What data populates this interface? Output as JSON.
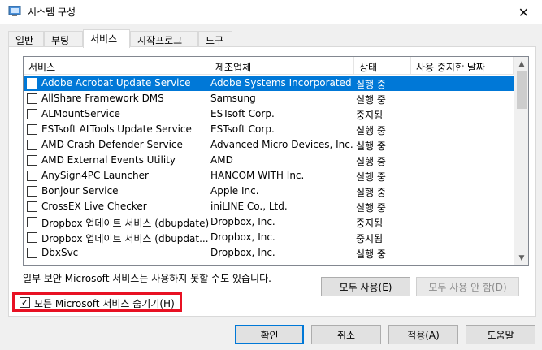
{
  "window": {
    "title": "시스템 구성",
    "close_glyph": "✕"
  },
  "tabs": [
    {
      "label": "일반"
    },
    {
      "label": "부팅"
    },
    {
      "label": "서비스"
    },
    {
      "label": "시작프로그램"
    },
    {
      "label": "도구"
    }
  ],
  "active_tab": "서비스",
  "columns": [
    "서비스",
    "제조업체",
    "상태",
    "사용 중지한 날짜"
  ],
  "services": [
    {
      "name": "Adobe Acrobat Update Service",
      "manufacturer": "Adobe Systems Incorporated",
      "status": "실행 중",
      "checked": false,
      "selected": true
    },
    {
      "name": "AllShare Framework DMS",
      "manufacturer": "Samsung",
      "status": "실행 중",
      "checked": false
    },
    {
      "name": "ALMountService",
      "manufacturer": "ESTsoft Corp.",
      "status": "중지됨",
      "checked": false
    },
    {
      "name": "ESTsoft ALTools Update Service",
      "manufacturer": "ESTsoft Corp.",
      "status": "실행 중",
      "checked": false
    },
    {
      "name": "AMD Crash Defender Service",
      "manufacturer": "Advanced Micro Devices, Inc.",
      "status": "실행 중",
      "checked": false
    },
    {
      "name": "AMD External Events Utility",
      "manufacturer": "AMD",
      "status": "실행 중",
      "checked": false
    },
    {
      "name": "AnySign4PC Launcher",
      "manufacturer": "HANCOM WITH Inc.",
      "status": "실행 중",
      "checked": false
    },
    {
      "name": "Bonjour Service",
      "manufacturer": "Apple Inc.",
      "status": "실행 중",
      "checked": false
    },
    {
      "name": "CrossEX Live Checker",
      "manufacturer": "iniLINE Co., Ltd.",
      "status": "실행 중",
      "checked": false
    },
    {
      "name": "Dropbox 업데이트 서비스 (dbupdate)",
      "manufacturer": "Dropbox, Inc.",
      "status": "중지됨",
      "checked": false
    },
    {
      "name": "Dropbox 업데이트 서비스 (dbupdat...",
      "manufacturer": "Dropbox, Inc.",
      "status": "중지됨",
      "checked": false
    },
    {
      "name": "DbxSvc",
      "manufacturer": "Dropbox, Inc.",
      "status": "실행 중",
      "checked": false
    }
  ],
  "note": "일부 보안 Microsoft 서비스는 사용하지 못할 수도 있습니다.",
  "buttons": {
    "enable_all": "모두 사용(E)",
    "disable_all": "모두 사용 안 함(D)",
    "ok": "확인",
    "cancel": "취소",
    "apply": "적용(A)",
    "help": "도움말"
  },
  "hide_ms": {
    "label": "모든 Microsoft 서비스 숨기기(H)",
    "checked": true,
    "check_glyph": "✓"
  },
  "scroll": {
    "up_glyph": "▲",
    "down_glyph": "▼"
  },
  "colors": {
    "selection": "#0078d7",
    "highlight_box": "#e81123"
  }
}
